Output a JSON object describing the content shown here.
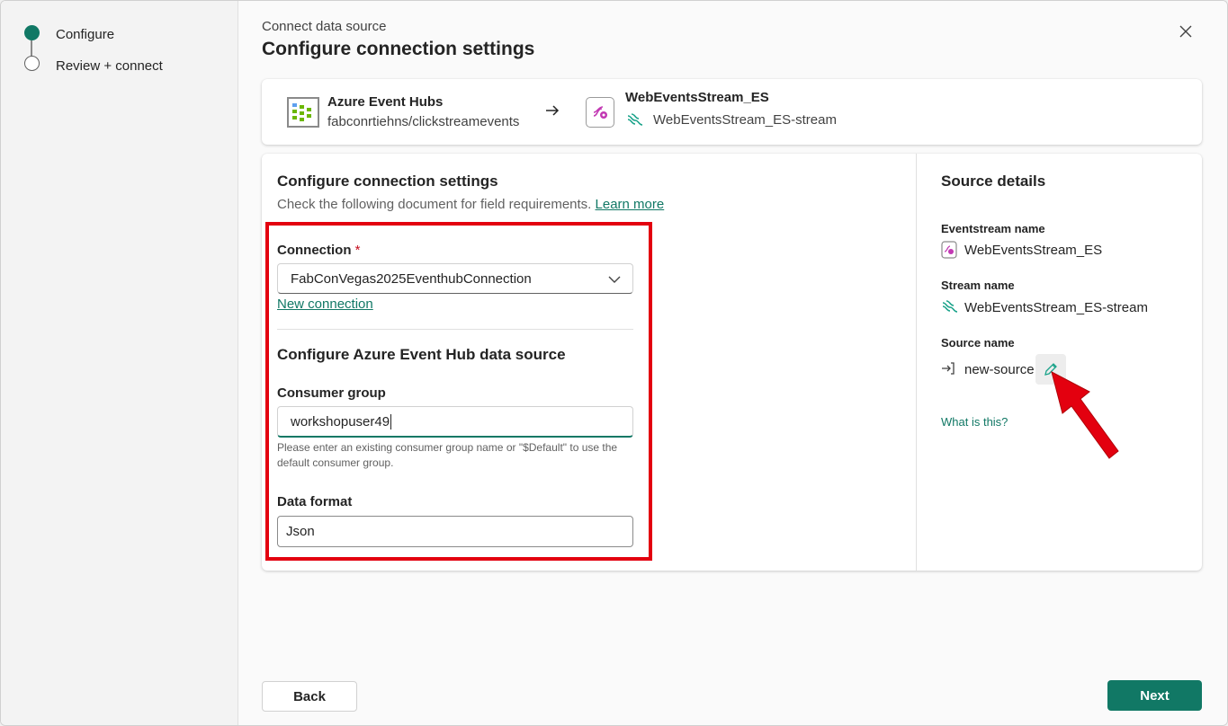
{
  "stepper": {
    "steps": [
      {
        "label": "Configure",
        "state": "active"
      },
      {
        "label": "Review + connect",
        "state": "pending"
      }
    ]
  },
  "header": {
    "breadcrumb": "Connect data source",
    "title": "Configure connection settings",
    "close_icon": "close-icon"
  },
  "source_summary": {
    "source_title": "Azure Event Hubs",
    "source_sub": "fabconrtiehns/clickstreamevents",
    "dest_title": "WebEventsStream_ES",
    "dest_sub": "WebEventsStream_ES-stream"
  },
  "form": {
    "title": "Configure connection settings",
    "desc": "Check the following document for field requirements.",
    "learn_more": "Learn more",
    "connection_label": "Connection",
    "required_mark": "*",
    "connection_value": "FabConVegas2025EventhubConnection",
    "new_connection": "New connection",
    "section_title": "Configure Azure Event Hub data source",
    "consumer_group_label": "Consumer group",
    "consumer_group_value": "workshopuser49",
    "consumer_group_hint": "Please enter an existing consumer group name or \"$Default\" to use the default consumer group.",
    "data_format_label": "Data format",
    "data_format_value": "Json"
  },
  "source_details": {
    "title": "Source details",
    "eventstream_label": "Eventstream name",
    "eventstream_value": "WebEventsStream_ES",
    "stream_label": "Stream name",
    "stream_value": "WebEventsStream_ES-stream",
    "source_label": "Source name",
    "source_value": "new-source",
    "what_is_this": "What is this?"
  },
  "footer": {
    "back": "Back",
    "next": "Next"
  },
  "colors": {
    "accent": "#117865",
    "annotation": "#e3000f"
  }
}
